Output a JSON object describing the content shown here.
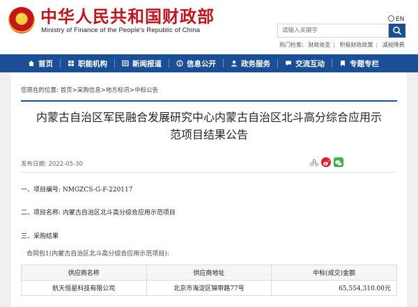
{
  "header": {
    "site_title": "中华人民共和国财政部",
    "site_subtitle": "Ministry of Finance of the People’s Republic of China",
    "lang_label": "EN",
    "search_placeholder": "请输入关键字",
    "hot_label": "热门检索:",
    "hot_words": [
      "财政收支",
      "积极财政政策",
      "减税降费"
    ]
  },
  "nav": {
    "items": [
      {
        "label": "首页",
        "icon": "home-icon"
      },
      {
        "label": "职能机构",
        "icon": "org-icon"
      },
      {
        "label": "新闻报道",
        "icon": "news-icon"
      },
      {
        "label": "信息公开",
        "icon": "info-icon"
      },
      {
        "label": "政务服务",
        "icon": "service-icon"
      },
      {
        "label": "交流互动",
        "icon": "interact-icon"
      },
      {
        "label": "专题专栏",
        "icon": "topic-icon"
      }
    ]
  },
  "breadcrumb": {
    "prefix": "您现在的位置:",
    "path": "首页>采购信息>地方标讯>中标公告"
  },
  "article": {
    "title_line1": "内蒙古自治区军民融合发展研究中心内蒙古自治区北斗高分综合应用示",
    "title_line2": "范项目结果公告",
    "pubdate_label": "发布日期: 2022-05-30",
    "sections": {
      "project_no": "一、项目编号: NMGZCS-G-F-220117",
      "project_name": "二、项目名称: 内蒙古自治区北斗高分综合应用示范项目",
      "result_heading": "三、采购结果",
      "contract_pkg": "合同包1(内蒙古自治区北斗高分综合应用示范项目):"
    },
    "table": {
      "headers": [
        "供应商名称",
        "供应商地址",
        "中标(成交)金额"
      ],
      "rows": [
        [
          "航天恒星科技有限公司",
          "北京市海淀区锦带路77号",
          "65,554,310.00元"
        ]
      ]
    }
  },
  "colors": {
    "brand_red": "#c3141b",
    "nav_blue": "#1a4f95"
  }
}
